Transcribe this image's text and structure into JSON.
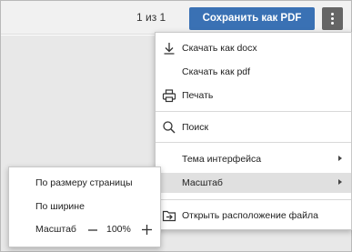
{
  "toolbar": {
    "page_counter": "1 из 1",
    "save_label": "Сохранить как PDF",
    "more_icon": "kebab-vertical-icon",
    "accent_color": "#3a71b4"
  },
  "menu": {
    "items": [
      {
        "label": "Скачать как docx",
        "icon": "download-icon"
      },
      {
        "label": "Скачать как pdf",
        "icon": ""
      },
      {
        "label": "Печать",
        "icon": "printer-icon"
      },
      {
        "label": "Поиск",
        "icon": "search-icon"
      },
      {
        "label": "Тема интерфейса",
        "icon": "",
        "submenu": true
      },
      {
        "label": "Масштаб",
        "icon": "",
        "submenu": true,
        "active": true
      },
      {
        "label": "Открыть расположение файла",
        "icon": "open-folder-icon"
      }
    ]
  },
  "zoom_submenu": {
    "fit_page_label": "По размеру страницы",
    "fit_width_label": "По ширине",
    "zoom_label": "Масштаб",
    "zoom_value": "100%"
  }
}
